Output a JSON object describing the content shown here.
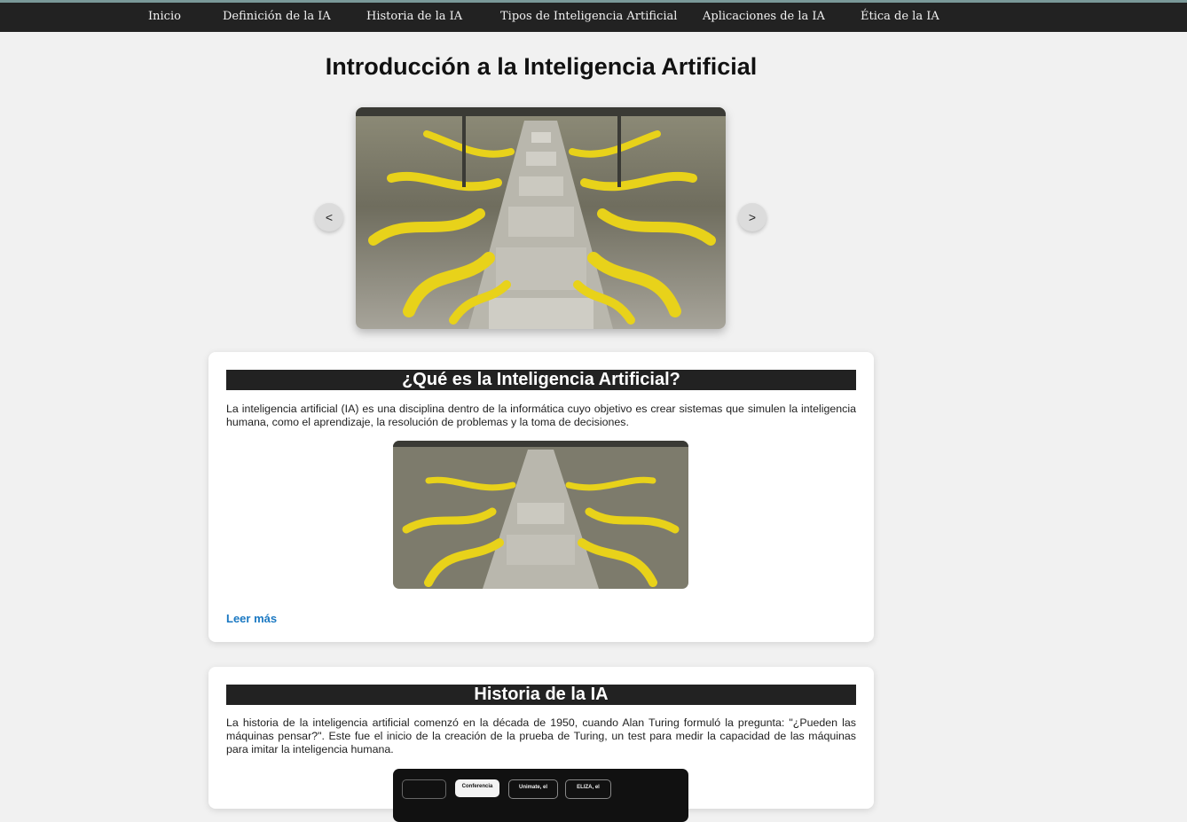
{
  "nav": {
    "items": [
      {
        "label": "Inicio"
      },
      {
        "label": "Definición de la IA"
      },
      {
        "label": "Historia de la IA"
      },
      {
        "label": "Tipos de Inteligencia Artificial"
      },
      {
        "label": "Aplicaciones de la IA"
      },
      {
        "label": "Ética de la IA"
      }
    ]
  },
  "page": {
    "title": "Introducción a la Inteligencia Artificial"
  },
  "carousel": {
    "prev_label": "<",
    "next_label": ">"
  },
  "sections": [
    {
      "heading": "¿Qué es la Inteligencia Artificial?",
      "text": "La inteligencia artificial (IA) es una disciplina dentro de la informática cuyo objetivo es crear sistemas que simulen la inteligencia humana, como el aprendizaje, la resolución de problemas y la toma de decisiones.",
      "link": "Leer más"
    },
    {
      "heading": "Historia de la IA",
      "text": "La historia de la inteligencia artificial comenzó en la década de 1950, cuando Alan Turing formuló la pregunta: \"¿Pueden las máquinas pensar?\". Este fue el inicio de la creación de la prueba de Turing, un test para medir la capacidad de las máquinas para imitar la inteligencia humana.",
      "timeline_labels": [
        "Conferencia",
        "Unimate, el",
        "ELIZA, el"
      ]
    }
  ],
  "colors": {
    "navbar": "#222222",
    "background": "#f1f1f1",
    "link": "#1a78c2",
    "robot_yellow": "#e8d21a"
  }
}
